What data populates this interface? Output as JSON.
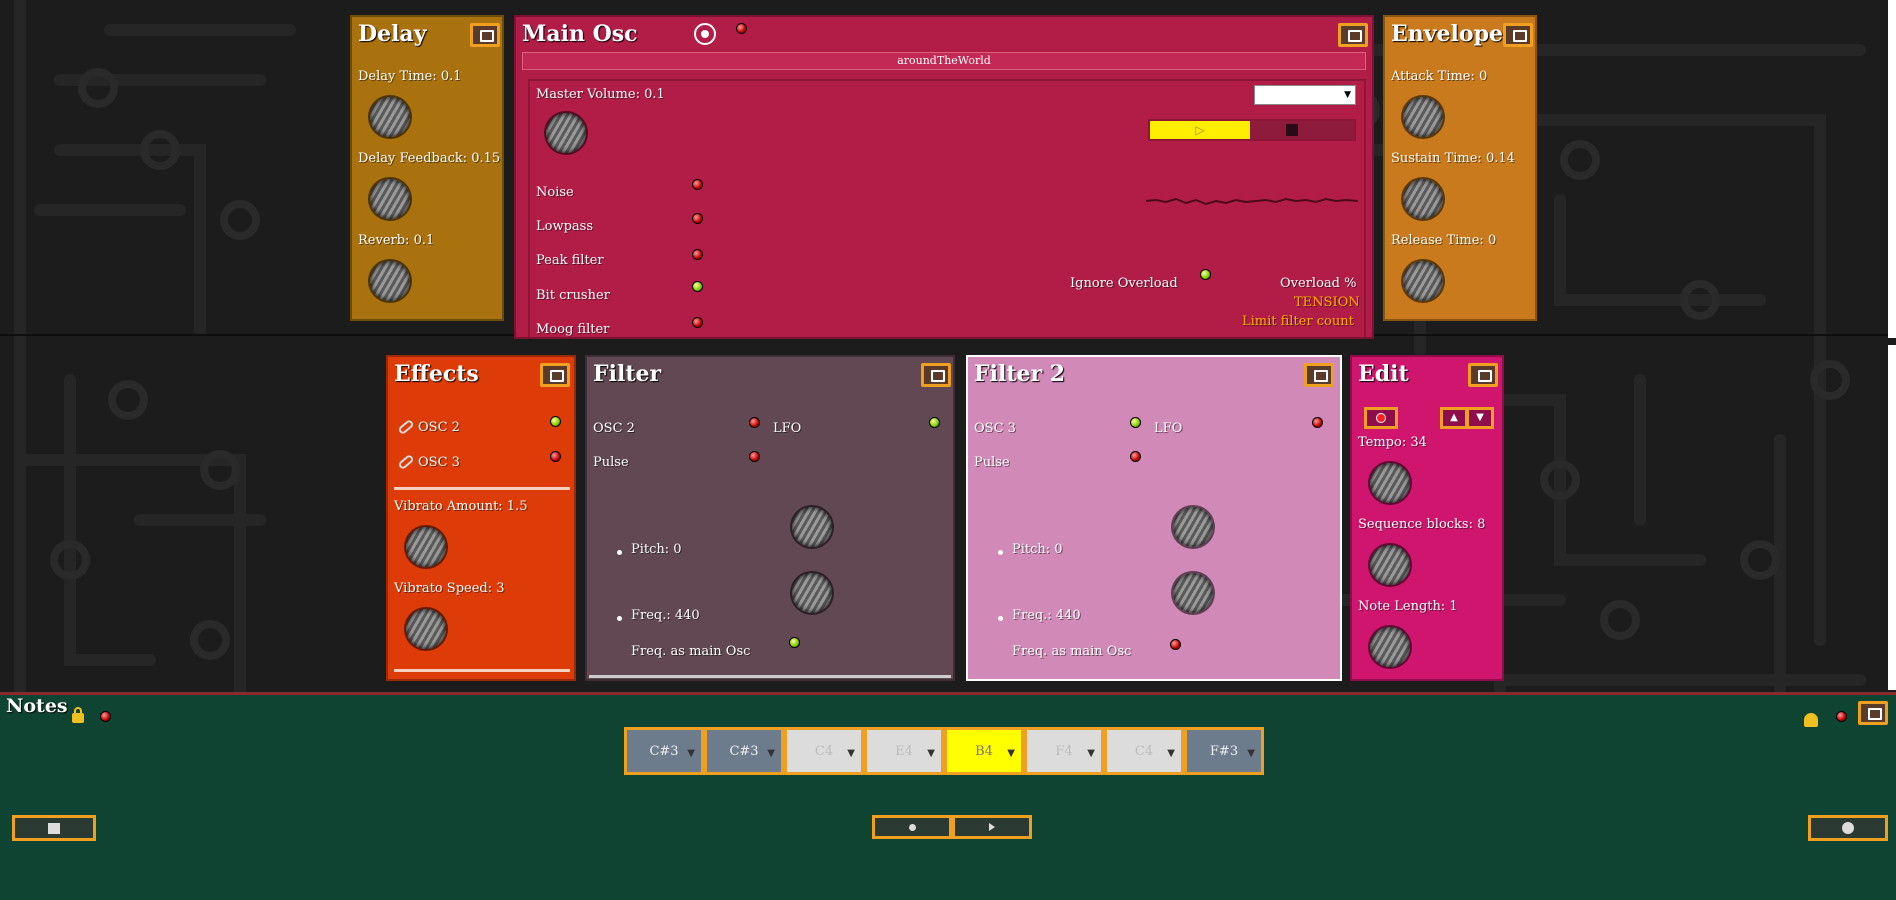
{
  "colors": {
    "delay": "#a9720e",
    "main_osc": "#b21d47",
    "envelope": "#c97a1c",
    "effects": "#dd3c08",
    "filter": "#614852",
    "filter2": "#d189b7",
    "edit": "#d0156e",
    "notes": "#0f4432"
  },
  "icons": {
    "expand": "expand-icon",
    "power": "power-icon",
    "link": "link-icon",
    "lock": "lock-icon",
    "bell": "bell-icon"
  },
  "delay": {
    "title": "Delay",
    "delay_time": "Delay Time: 0.1",
    "delay_feedback": "Delay Feedback: 0.15",
    "reverb": "Reverb: 0.1"
  },
  "main_osc": {
    "title": "Main Osc",
    "sound_name": "aroundTheWorld",
    "master_volume": "Master Volume: 0.1",
    "rows": [
      "Noise",
      "Lowpass",
      "Peak filter",
      "Bit crusher",
      "Moog filter"
    ],
    "ignore_overload": "Ignore Overload",
    "overload": "Overload %",
    "tension": "TENSION",
    "limit_filter": "Limit filter count",
    "transport_play": "▷",
    "select_value": ""
  },
  "envelope": {
    "title": "Envelope",
    "attack": "Attack Time: 0",
    "sustain": "Sustain Time: 0.14",
    "release": "Release Time: 0"
  },
  "effects": {
    "title": "Effects",
    "osc2": "OSC 2",
    "osc3": "OSC 3",
    "vibrato_amount": "Vibrato Amount: 1.5",
    "vibrato_speed": "Vibrato Speed: 3"
  },
  "filter": {
    "title": "Filter",
    "osc": "OSC 2",
    "lfo": "LFO",
    "pulse": "Pulse",
    "pitch": "Pitch: 0",
    "freq": "Freq.: 440",
    "freq_main": "Freq. as main Osc"
  },
  "filter2": {
    "title": "Filter 2",
    "osc": "OSC 3",
    "lfo": "LFO",
    "pulse": "Pulse",
    "pitch": "Pitch: 0",
    "freq": "Freq.: 440",
    "freq_main": "Freq. as main Osc"
  },
  "edit": {
    "title": "Edit",
    "tempo": "Tempo: 34",
    "sequence_blocks": "Sequence blocks: 8",
    "note_length": "Note Length: 1"
  },
  "notes": {
    "title": "Notes",
    "sequence": [
      {
        "label": "C#3",
        "state": "filled"
      },
      {
        "label": "C#3",
        "state": "filled"
      },
      {
        "label": "C4",
        "state": "empty"
      },
      {
        "label": "E4",
        "state": "empty"
      },
      {
        "label": "B4",
        "state": "active"
      },
      {
        "label": "F4",
        "state": "empty"
      },
      {
        "label": "C4",
        "state": "empty"
      },
      {
        "label": "F#3",
        "state": "filled"
      }
    ]
  }
}
